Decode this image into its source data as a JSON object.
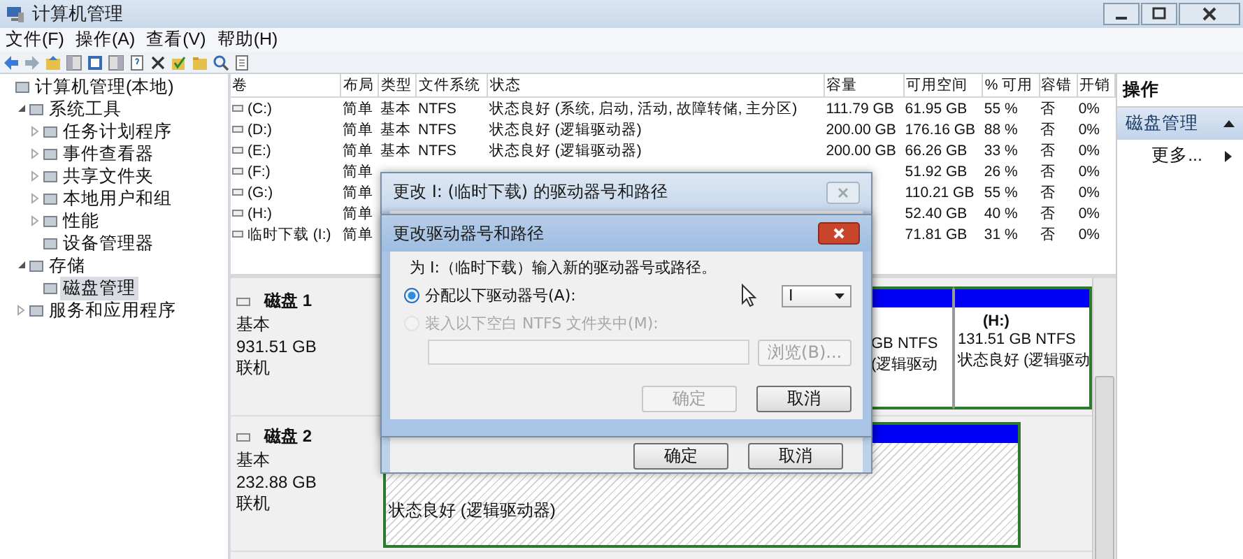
{
  "window": {
    "title": "计算机管理"
  },
  "menu": [
    "文件(F)",
    "操作(A)",
    "查看(V)",
    "帮助(H)"
  ],
  "tree": [
    {
      "label": "计算机管理(本地)",
      "selected": false,
      "children": [
        {
          "label": "系统工具",
          "expanded": true,
          "selected": false,
          "children": [
            {
              "label": "任务计划程序",
              "expanded": false,
              "selected": false
            },
            {
              "label": "事件查看器",
              "expanded": false,
              "selected": false
            },
            {
              "label": "共享文件夹",
              "expanded": false,
              "selected": false
            },
            {
              "label": "本地用户和组",
              "expanded": false,
              "selected": false
            },
            {
              "label": "性能",
              "expanded": false,
              "selected": false
            },
            {
              "label": "设备管理器",
              "selected": false
            }
          ]
        },
        {
          "label": "存储",
          "expanded": true,
          "selected": false,
          "children": [
            {
              "label": "磁盘管理",
              "selected": true
            }
          ]
        },
        {
          "label": "服务和应用程序",
          "expanded": false,
          "selected": false
        }
      ]
    }
  ],
  "table": {
    "columns": [
      "卷",
      "布局",
      "类型",
      "文件系统",
      "状态",
      "容量",
      "可用空间",
      "% 可用",
      "容错",
      "开销"
    ],
    "rows": [
      {
        "volume": "(C:)",
        "layout": "简单",
        "type": "基本",
        "file_system": "NTFS",
        "status": "状态良好 (系统, 启动, 活动, 故障转储, 主分区)",
        "capacity": "111.79 GB",
        "free_space": "61.95 GB",
        "percent_free": "55 %",
        "fault_tolerance": "否",
        "overhead": "0%"
      },
      {
        "volume": "(D:)",
        "layout": "简单",
        "type": "基本",
        "file_system": "NTFS",
        "status": "状态良好 (逻辑驱动器)",
        "capacity": "200.00 GB",
        "free_space": "176.16 GB",
        "percent_free": "88 %",
        "fault_tolerance": "否",
        "overhead": "0%"
      },
      {
        "volume": "(E:)",
        "layout": "简单",
        "type": "基本",
        "file_system": "NTFS",
        "status": "状态良好 (逻辑驱动器)",
        "capacity": "200.00 GB",
        "free_space": "66.26 GB",
        "percent_free": "33 %",
        "fault_tolerance": "否",
        "overhead": "0%"
      },
      {
        "volume": "(F:)",
        "layout": "简单",
        "free_space": "51.92 GB",
        "percent_free": "26 %",
        "fault_tolerance": "否",
        "overhead": "0%"
      },
      {
        "volume": "(G:)",
        "layout": "简单",
        "free_space": "110.21 GB",
        "percent_free": "55 %",
        "fault_tolerance": "否",
        "overhead": "0%"
      },
      {
        "volume": "(H:)",
        "layout": "简单",
        "free_space": "52.40 GB",
        "percent_free": "40 %",
        "fault_tolerance": "否",
        "overhead": "0%"
      },
      {
        "volume": "临时下载 (I:)",
        "layout": "简单",
        "free_space": "71.81 GB",
        "percent_free": "31 %",
        "fault_tolerance": "否",
        "overhead": "0%"
      }
    ]
  },
  "disks": [
    {
      "name": "磁盘 1",
      "type": "基本",
      "size": "931.51 GB",
      "status": "联机",
      "partitions": [
        {
          "selected": false,
          "lines": [
            "GB NTFS",
            "(逻辑驱动"
          ]
        },
        {
          "selected": false,
          "label": "(H:)",
          "lines": [
            "131.51 GB NTFS",
            "状态良好 (逻辑驱动"
          ]
        }
      ]
    },
    {
      "name": "磁盘 2",
      "type": "基本",
      "size": "232.88 GB",
      "status": "联机",
      "partitions": [
        {
          "selected": true,
          "lines": [
            "状态良好 (逻辑驱动器)"
          ]
        }
      ]
    }
  ],
  "actions": {
    "title": "操作",
    "items": [
      {
        "kind": "section",
        "label": "磁盘管理"
      },
      {
        "kind": "link",
        "label": "更多..."
      }
    ]
  },
  "back_dialog": {
    "title": "更改 I: (临时下载) 的驱动器号和路径",
    "buttons": [
      "确定",
      "取消"
    ]
  },
  "dialog": {
    "title": "更改驱动器号和路径",
    "prompt": "为 I:（临时下载）输入新的驱动器号或路径。",
    "options": [
      {
        "label": "分配以下驱动器号(A):",
        "selected": true,
        "disabled": false
      },
      {
        "label": "装入以下空白 NTFS 文件夹中(M):",
        "selected": false,
        "disabled": true
      }
    ],
    "drive_letter": "I",
    "browse": {
      "label": "浏览(B)...",
      "disabled": true
    },
    "buttons": [
      {
        "label": "确定",
        "disabled": true
      },
      {
        "label": "取消",
        "disabled": false
      }
    ]
  }
}
